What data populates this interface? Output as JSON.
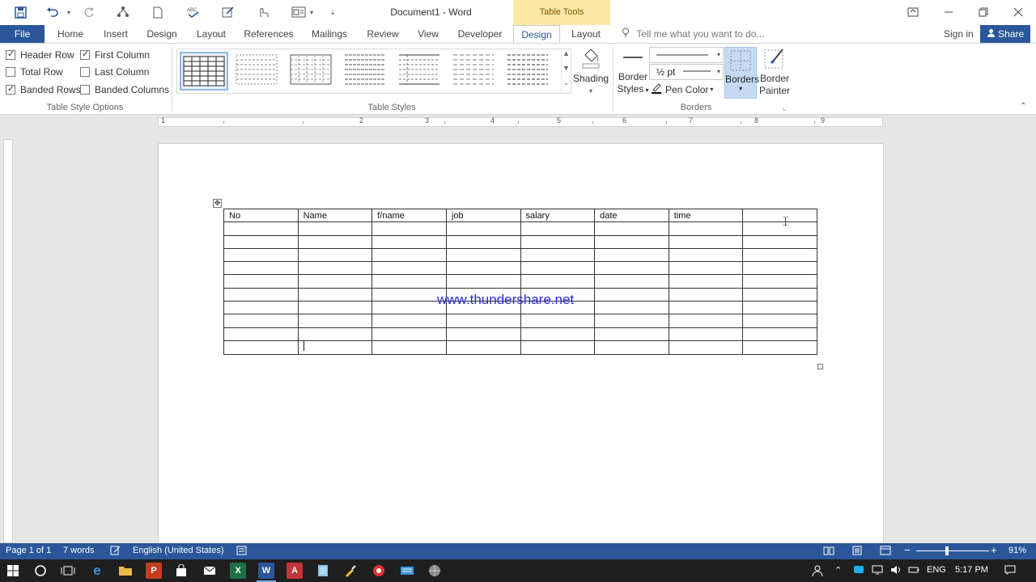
{
  "title_bar": {
    "document_title": "Document1 - Word",
    "context_tab_group": "Table Tools"
  },
  "tabs": {
    "file": "File",
    "home": "Home",
    "insert": "Insert",
    "design": "Design",
    "layout": "Layout",
    "references": "References",
    "mailings": "Mailings",
    "review": "Review",
    "view": "View",
    "developer": "Developer",
    "table_design": "Design",
    "table_layout": "Layout",
    "tell_me": "Tell me what you want to do...",
    "sign_in": "Sign in",
    "share": "Share"
  },
  "ribbon": {
    "table_style_options": {
      "header_row": "Header Row",
      "first_column": "First Column",
      "total_row": "Total Row",
      "last_column": "Last Column",
      "banded_rows": "Banded Rows",
      "banded_columns": "Banded Columns",
      "group_label": "Table Style Options"
    },
    "table_styles": {
      "group_label": "Table Styles",
      "shading": "Shading"
    },
    "borders": {
      "border_styles_1": "Border",
      "border_styles_2": "Styles",
      "pen_weight": "½ pt",
      "pen_color": "Pen Color",
      "borders": "Borders",
      "border_painter_1": "Border",
      "border_painter_2": "Painter",
      "group_label": "Borders"
    }
  },
  "document": {
    "table_header": [
      "No",
      "Name",
      "f/name",
      "job",
      "salary",
      "date",
      "time",
      ""
    ],
    "watermark": "www.thundershare.net"
  },
  "status_bar": {
    "page": "Page 1 of 1",
    "words": "7 words",
    "language": "English (United States)",
    "zoom": "91%"
  },
  "taskbar": {
    "lang": "ENG",
    "time": "5:17 PM"
  },
  "colors": {
    "accent": "#2b579a",
    "context_tab": "#fde8a7",
    "watermark": "#2a2ad0"
  }
}
